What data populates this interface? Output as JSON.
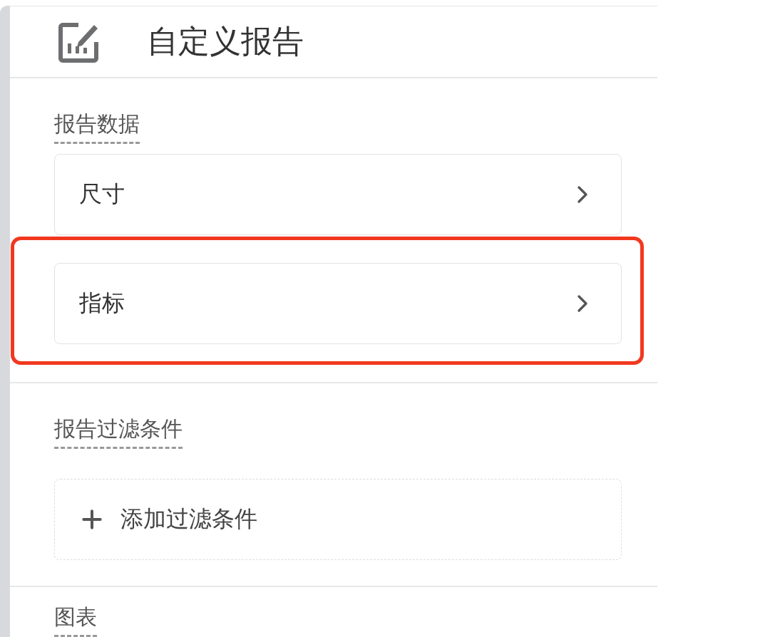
{
  "header": {
    "title": "自定义报告"
  },
  "sections": [
    {
      "kind": "list",
      "label": "报告数据",
      "items": [
        {
          "label": "尺寸",
          "highlighted": false
        },
        {
          "label": "指标",
          "highlighted": true
        }
      ]
    },
    {
      "kind": "add",
      "label": "报告过滤条件",
      "add_button": "添加过滤条件"
    },
    {
      "kind": "heading",
      "label": "图表"
    }
  ]
}
